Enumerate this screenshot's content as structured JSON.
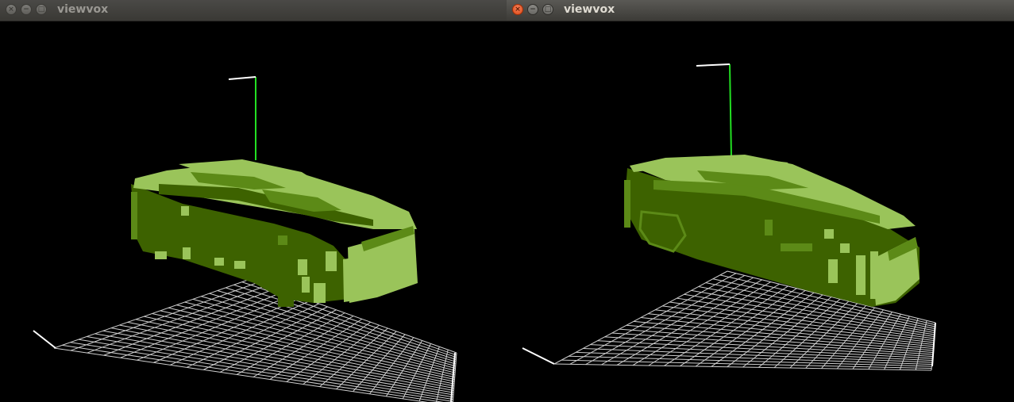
{
  "windows": [
    {
      "title": "viewvox",
      "state": "inactive",
      "buttons": [
        "close-icon",
        "minimize-icon",
        "maximize-icon"
      ],
      "button_glyphs": {
        "close": "×",
        "minimize": "−",
        "maximize": "□"
      }
    },
    {
      "title": "viewvox",
      "state": "active",
      "buttons": [
        "close-icon",
        "minimize-icon",
        "maximize-icon"
      ],
      "button_glyphs": {
        "close": "×",
        "minimize": "−",
        "maximize": "□"
      }
    }
  ],
  "colors": {
    "voxel_light": "#9ac45a",
    "voxel_dark": "#3d6200",
    "voxel_mid": "#5c8a17",
    "grid": "#cfcfcf",
    "axis_y": "#22e022",
    "axis_other": "#ffffff",
    "background": "#000000"
  }
}
